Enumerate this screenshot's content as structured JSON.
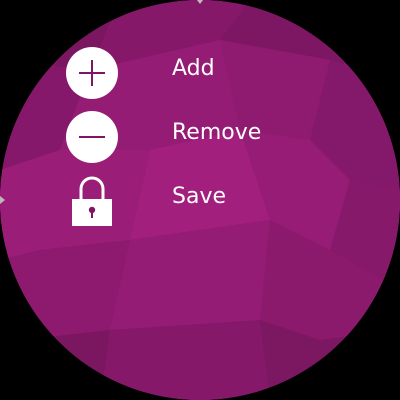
{
  "menu": {
    "items": [
      {
        "label": "Add",
        "icon": "plus-circle-icon"
      },
      {
        "label": "Remove",
        "icon": "minus-circle-icon"
      },
      {
        "label": "Save",
        "icon": "lock-icon"
      }
    ]
  },
  "colors": {
    "background": "#000000",
    "accent": "#8e1a6e",
    "text": "#ffffff"
  }
}
